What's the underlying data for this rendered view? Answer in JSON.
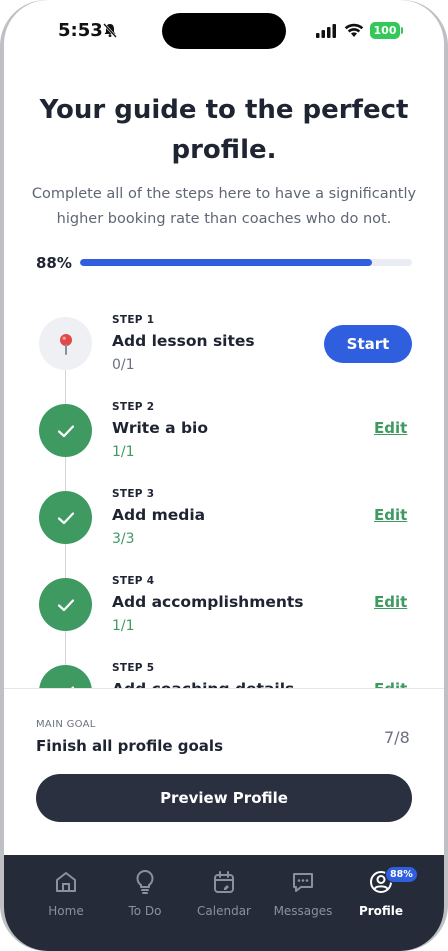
{
  "status_bar": {
    "time": "5:53",
    "battery": "100"
  },
  "header": {
    "title": "Your guide to the perfect profile.",
    "subtitle": "Complete all of the steps here to have a significantly higher booking rate than coaches who do not."
  },
  "progress": {
    "label": "88%",
    "value": 0.88
  },
  "steps": [
    {
      "label": "STEP 1",
      "title": "Add lesson sites",
      "count": "0/1",
      "action": "Start",
      "done": false
    },
    {
      "label": "STEP 2",
      "title": "Write a bio",
      "count": "1/1",
      "action": "Edit",
      "done": true
    },
    {
      "label": "STEP 3",
      "title": "Add media",
      "count": "3/3",
      "action": "Edit",
      "done": true
    },
    {
      "label": "STEP 4",
      "title": "Add accomplishments",
      "count": "1/1",
      "action": "Edit",
      "done": true
    },
    {
      "label": "STEP 5",
      "title": "Add coaching details",
      "count": "",
      "action": "Edit",
      "done": true
    }
  ],
  "main_goal": {
    "label": "MAIN GOAL",
    "text": "Finish all profile goals",
    "count": "7/8"
  },
  "preview_button": "Preview Profile",
  "tabbar": {
    "tabs": [
      {
        "label": "Home",
        "icon": "home-icon"
      },
      {
        "label": "To Do",
        "icon": "lightbulb-icon"
      },
      {
        "label": "Calendar",
        "icon": "calendar-icon"
      },
      {
        "label": "Messages",
        "icon": "message-icon"
      },
      {
        "label": "Profile",
        "icon": "profile-icon",
        "badge": "88%"
      }
    ],
    "active": "Profile"
  },
  "colors": {
    "accent": "#2f5fde",
    "success": "#3f9a62",
    "dark": "#262b3a",
    "text": "#1f2433"
  }
}
